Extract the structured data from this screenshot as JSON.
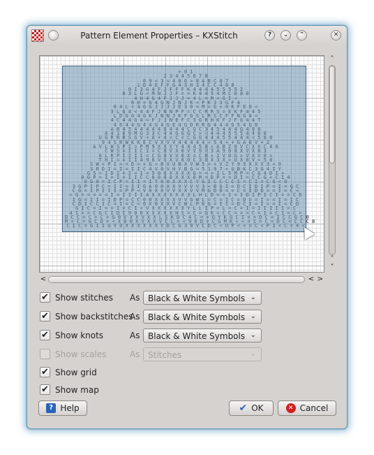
{
  "window": {
    "title": "Pattern Element Properties – KXStitch",
    "buttons": {
      "help": "?",
      "minimize": "⌄",
      "maximize": "⌃",
      "close": "✕"
    }
  },
  "preview": {
    "symbol_rows": [
      "+ 0 1",
      "2 3 4 4 5 6 7 8",
      "0 9 < 3 = 4 8 6 > 8 A B C 8 7",
      "1 D 4 E F F G 4 3 H 3 4 C C 4 8 8",
      "0 I 3 G 4 F J F F F K 4 4 4 4 5 5 5 5 2",
      "0 3 L G < M N J J F = = K 4 4 5 4 M C 0 8 0",
      "4 H 4 G 4 F J J J = 4 L = M < G I <",
      "6 H = G 4 G N J N J K < P K 3 3 G F 4",
      "0 4 L < 4 G G J J J J E 3 0 = M = G < 0 K F E 0 <",
      "3 L G 4 < 4 4 F J N N P F = C C R R S = E K F 4 4 5",
      "L D G G 4 G K J N N J K F G S L R S C F F N G 4 <",
      "4 C 4 4 G 4 = F J J N E F C 3 G R H K F J F G 4 4 T",
      "4 6 4 4 G 4 4 G 4 G E 4 G D R R G 4 4 4 G 5 4 G 8",
      "A B 4 5 4 4 4 4 4 8 4 4 4 C G C 3 4 5 4 4 4 G 4 8 8",
      "A 4 1 6 9 M G 3 3 C 4 4 G G G C > < 4 4 4 5 5 5 4 4 8 8",
      "U G R R R S G V + A + 4 < C < C G G 4 4 4 5 5 4 4 4 < 5 8 0",
      "9 4 S R W K K E C V X V V 4 4 4 4 4 < 5 4 + + G A 0 V + 2",
      "A V L W S P I = P M 9 X X V Y 4 4 4 5 8 < A B Z 0 V C X X C 4 6",
      "C W S = I I C I = C 0 V X 0 V V 9 V 3 A 9 0 8 X V X 0 3",
      "0 L R P I I I I = C G 8 V V 0 X = C B + I V 0 G > V X V 0 >",
      "T H I = = I I 4 9 6 V V X V 0 0 C 3 0 X 3 X > U X 0 V < 5 0",
      "S W < P I = = D = = G > B X U B X V W 5 = + V Z Y 9 9 X X V 3 < 0",
      "3 R D I = I = I I C 4 V 0 V H Y B G = 5 1 9 7 + U B K C 3 G 4 I Y",
      "G 5 = I D I = I = I = 5 0 0 X X X X G = = = I L 5 M P = C G 4 D I >",
      "0 G P = I = I = I I C C 0 0 0 0 X X X 0 M = D P = = D I = C C G < C I 4",
      "0 G 0 = I C P = I I = I T 0 0 X X X C Y G I C C C C I = C I = C G < 0",
      "3 G P I P C = I I = I I G A 0 0 X X V V V V 3 < B G I = D C I D I P = I = G C",
      "C G = I P I I I = P P < V 0 X X V V X X V V M G D D = = C = I D D = = I = C <",
      "< G = = = = = I = I I I I A X X X X X X 3 L H L D = = I = I D I P I C I = = C 6",
      "I G = I I = I D P = C C 0 0 X X X X V V G W L = C = I C = D = = I = = I = I C",
      "C D I C C I C = I = C < 0 X 0 X X V C W L P K G = I I = D C I = I = = I = C D",
      "G I C = I = = I < C I < V X X X X X X Y L L I P = L = C = I = I I I I I = C",
      "4 I = = C G C I D C 9 0 0 X X X X X H S = C = G K < C C = = = C = I = C I = C >",
      "D C C = C = C = G 0 V X X V X X L S K D C 4 C = = G Y K G C I = = D C = I C C G C 0",
      "M = C = G C D = < X 0 0 X V X X V C L = < 9 0 D = C G M K < < = I = C = D C = C C C 8",
      "C I C = G I I G V 0 X X X X X X V D C G 3 0 V C D C < U P < < = C < P I < C = 4 <"
    ]
  },
  "options": [
    {
      "label": "Show stitches",
      "checked": true,
      "enabled": true,
      "as_label": "As",
      "value": "Black & White Symbols"
    },
    {
      "label": "Show backstitches",
      "checked": true,
      "enabled": true,
      "as_label": "As",
      "value": "Black & White Symbols"
    },
    {
      "label": "Show knots",
      "checked": true,
      "enabled": true,
      "as_label": "As",
      "value": "Black & White Symbols"
    },
    {
      "label": "Show scales",
      "checked": false,
      "enabled": false,
      "as_label": "As",
      "value": "Stitches"
    },
    {
      "label": "Show grid",
      "checked": true,
      "enabled": true
    },
    {
      "label": "Show map",
      "checked": true,
      "enabled": true
    }
  ],
  "scroll": {
    "up": "˄",
    "down": "˅",
    "left": "<",
    "right": ">"
  },
  "check_mark": "✔",
  "combo_chevron": "⌄",
  "buttons": {
    "help_label": "Help",
    "help_icon_glyph": "?",
    "ok_label": "OK",
    "ok_icon_glyph": "✔",
    "cancel_label": "Cancel",
    "cancel_icon_glyph": "✕"
  },
  "colors": {
    "window_bg": "#d6d2d0",
    "focus_glow": "#5f9ab8",
    "map_overlay": "#6e96b4",
    "accent_blue": "#2a64b8",
    "cancel_red": "#d21e1e"
  }
}
